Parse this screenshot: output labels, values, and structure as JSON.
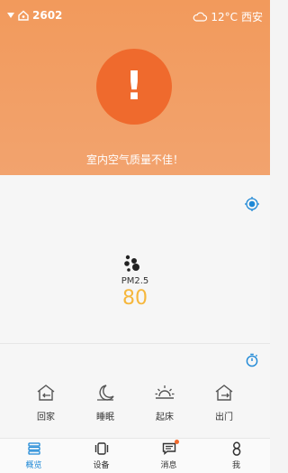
{
  "header": {
    "home_id": "2602",
    "weather_temp": "12°C",
    "city": "西安",
    "alert_message": "室内空气质量不佳！"
  },
  "pm": {
    "label": "PM2.5",
    "value": "80"
  },
  "scenes": [
    {
      "label": "回家"
    },
    {
      "label": "睡眠"
    },
    {
      "label": "起床"
    },
    {
      "label": "出门"
    }
  ],
  "nav": [
    {
      "label": "概览"
    },
    {
      "label": "设备"
    },
    {
      "label": "消息"
    },
    {
      "label": "我"
    }
  ],
  "colors": {
    "hero_orange": "#f29a5c",
    "alert_orange": "#ef6a2d",
    "pm_value_yellow": "#f6b73c",
    "active_blue": "#1e88d6"
  }
}
